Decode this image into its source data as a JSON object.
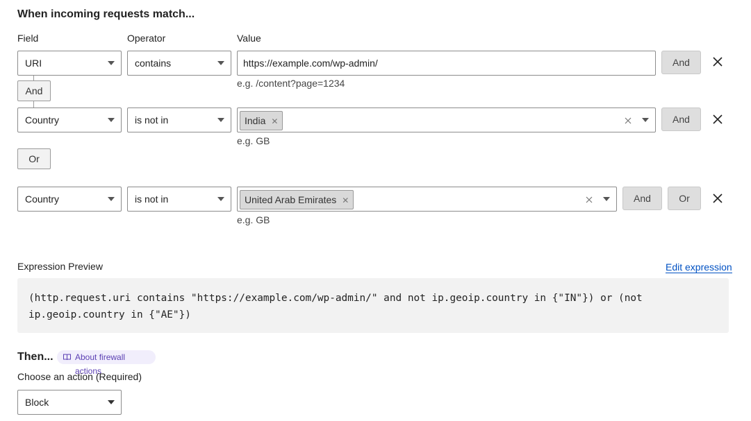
{
  "section_title": "When incoming requests match...",
  "columns": {
    "field": "Field",
    "operator": "Operator",
    "value": "Value"
  },
  "rule1": {
    "field": "URI",
    "operator": "contains",
    "value": "https://example.com/wp-admin/",
    "hint": "e.g. /content?page=1234",
    "and_label": "And"
  },
  "connector_and": "And",
  "rule2": {
    "field": "Country",
    "operator": "is not in",
    "tag": "India",
    "hint": "e.g. GB",
    "and_label": "And"
  },
  "connector_or": "Or",
  "rule3": {
    "field": "Country",
    "operator": "is not in",
    "tag": "United Arab Emirates",
    "hint": "e.g. GB",
    "and_label": "And",
    "or_label": "Or"
  },
  "expression": {
    "label": "Expression Preview",
    "edit_link": "Edit expression",
    "line1": "(http.request.uri contains \"https://example.com/wp-admin/\" and not ip.geoip.country in {\"IN\"}) or (not",
    "line2": "ip.geoip.country in {\"AE\"})"
  },
  "then": {
    "title": "Then...",
    "about_pill": "About firewall actions",
    "choose_label": "Choose an action (Required)",
    "action": "Block"
  },
  "icons": {
    "remove": "close-icon",
    "dropdown": "chevron-down-icon",
    "clear": "clear-icon",
    "docs": "book-icon"
  },
  "colors": {
    "link": "#0051c3",
    "pill_bg": "#f1eefc",
    "pill_text": "#5b3fb3",
    "button_bg": "#dedede",
    "preview_bg": "#f2f2f2"
  }
}
